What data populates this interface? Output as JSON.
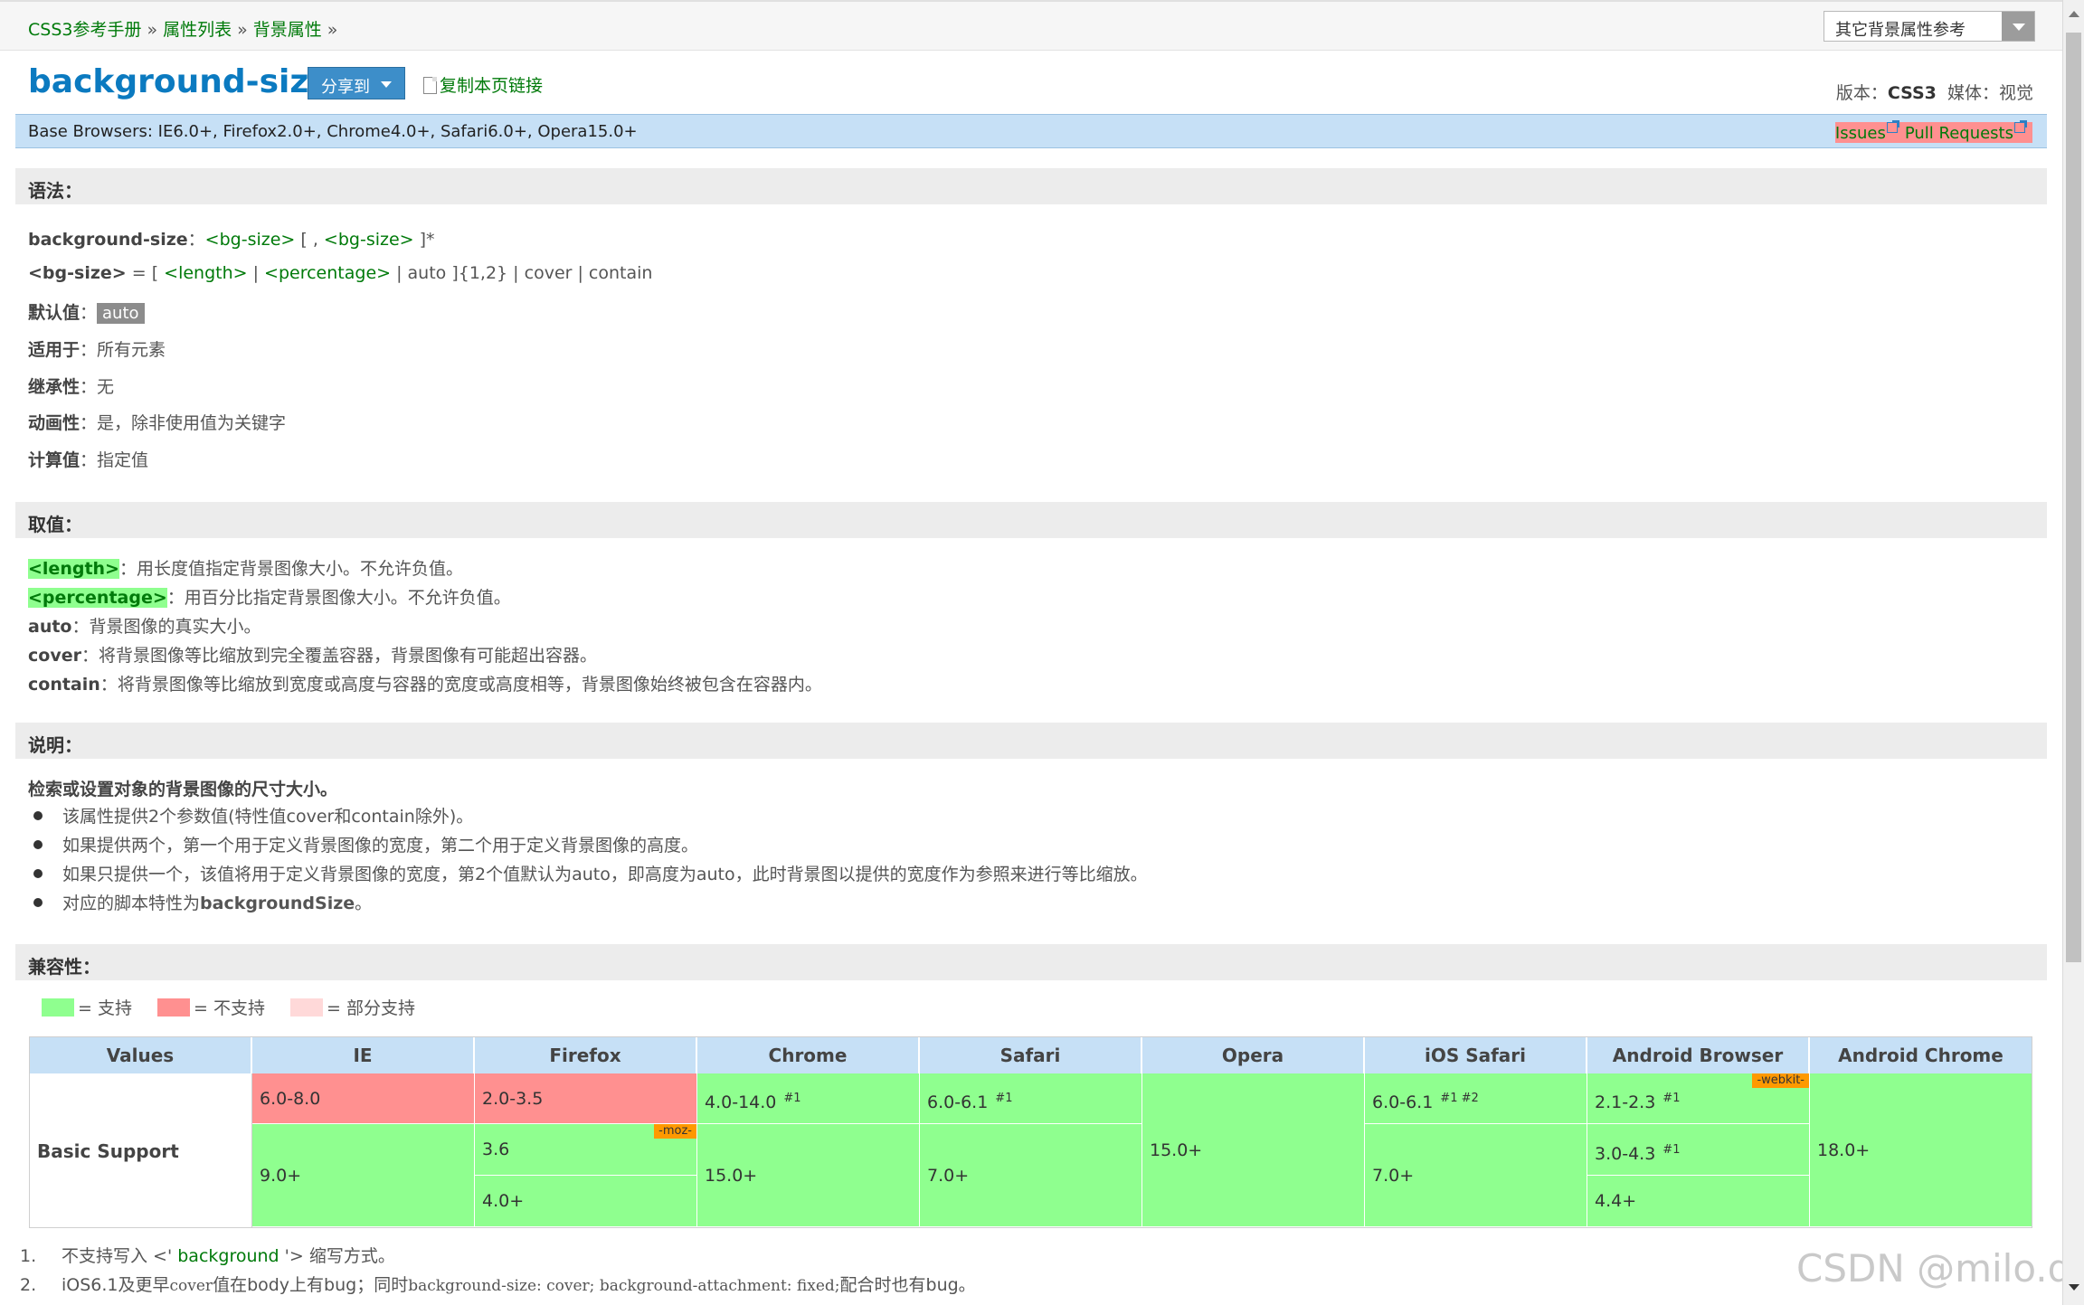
{
  "breadcrumb": {
    "items": [
      "CSS3参考手册",
      "属性列表",
      "背景属性"
    ],
    "separator": "»"
  },
  "ref_select": {
    "label": "其它背景属性参考"
  },
  "header": {
    "title": "background-size",
    "share_label": "分享到",
    "copy_link_label": "复制本页链接",
    "version_label": "版本：",
    "version_value": "CSS3",
    "media_label": "媒体：",
    "media_value": "视觉"
  },
  "base_browsers": {
    "text": "Base Browsers: IE6.0+, Firefox2.0+, Chrome4.0+, Safari6.0+, Opera15.0+",
    "issues": "Issues",
    "pull_requests": "Pull Requests"
  },
  "syntax": {
    "heading": "语法：",
    "line1": {
      "prop": "background-size",
      "colon": "：",
      "a": "<bg-size>",
      "b": " [ , ",
      "c": "<bg-size>",
      "d": " ]*"
    },
    "line2": {
      "name": "<bg-size>",
      "eq": " = [ ",
      "len": "<length>",
      "sep1": " | ",
      "pct": "<percentage>",
      "rest": " | auto ]{1,2} | cover | contain"
    },
    "default_label": "默认值",
    "default_value": "auto",
    "applies_label": "适用于",
    "applies_value": "所有元素",
    "inherit_label": "继承性",
    "inherit_value": "无",
    "anim_label": "动画性",
    "anim_value": "是，除非使用值为关键字",
    "computed_label": "计算值",
    "computed_value": "指定值",
    "sep": "："
  },
  "values": {
    "heading": "取值：",
    "items": [
      {
        "name": "<length>",
        "desc": "用长度值指定背景图像大小。不允许负值。"
      },
      {
        "name": "<percentage>",
        "desc": "用百分比指定背景图像大小。不允许负值。"
      },
      {
        "name": "auto",
        "desc": "背景图像的真实大小。"
      },
      {
        "name": "cover",
        "desc": "将背景图像等比缩放到完全覆盖容器，背景图像有可能超出容器。"
      },
      {
        "name": "contain",
        "desc": "将背景图像等比缩放到宽度或高度与容器的宽度或高度相等，背景图像始终被包含在容器内。"
      }
    ],
    "sep": "："
  },
  "description": {
    "heading": "说明：",
    "intro": "检索或设置对象的背景图像的尺寸大小。",
    "items": [
      "该属性提供2个参数值(特性值cover和contain除外)。",
      "如果提供两个，第一个用于定义背景图像的宽度，第二个用于定义背景图像的高度。",
      "如果只提供一个，该值将用于定义背景图像的宽度，第2个值默认为auto，即高度为auto，此时背景图以提供的宽度作为参照来进行等比缩放。"
    ],
    "last_prefix": "对应的脚本特性为",
    "last_bold": "backgroundSize",
    "last_suffix": "。"
  },
  "compat": {
    "heading": "兼容性：",
    "legend": [
      {
        "color": "#8fff8f",
        "label": "= 支持"
      },
      {
        "color": "#ff9090",
        "label": "= 不支持"
      },
      {
        "color": "#ffd9d9",
        "label": "= 部分支持"
      }
    ],
    "columns": [
      "Values",
      "IE",
      "Firefox",
      "Chrome",
      "Safari",
      "Opera",
      "iOS Safari",
      "Android Browser",
      "Android Chrome"
    ],
    "row_label": "Basic Support",
    "cells": {
      "ie_a": "6.0-8.0",
      "ie_b": "9.0+",
      "ff_a": "2.0-3.5",
      "ff_b": "3.6",
      "ff_b_prefix": "-moz-",
      "ff_c": "4.0+",
      "ch_a": "4.0-14.0",
      "ch_a_sup": "#1",
      "ch_b": "15.0+",
      "sf_a": "6.0-6.1",
      "sf_a_sup": "#1",
      "sf_b": "7.0+",
      "op_a": "15.0+",
      "ios_a": "6.0-6.1",
      "ios_a_sup": "#1 #2",
      "ios_b": "7.0+",
      "ab_a": "2.1-2.3",
      "ab_a_sup": "#1",
      "ab_a_prefix": "-webkit-",
      "ab_b": "3.0-4.3",
      "ab_b_sup": "#1",
      "ab_c": "4.4+",
      "ac_a": "18.0+"
    }
  },
  "notes": {
    "n1": {
      "num": "1.",
      "a": "不支持写入 <' ",
      "link": "background",
      "b": " '> 缩写方式。"
    },
    "n2": {
      "num": "2.",
      "a": "iOS6.1及更早",
      "m1": "cover",
      "b": "值在body上有bug；同时",
      "m2": "background-size: cover; background-attachment: fixed;",
      "c": "配合时也有bug。"
    }
  },
  "watermark": "CSDN @milo.qu"
}
